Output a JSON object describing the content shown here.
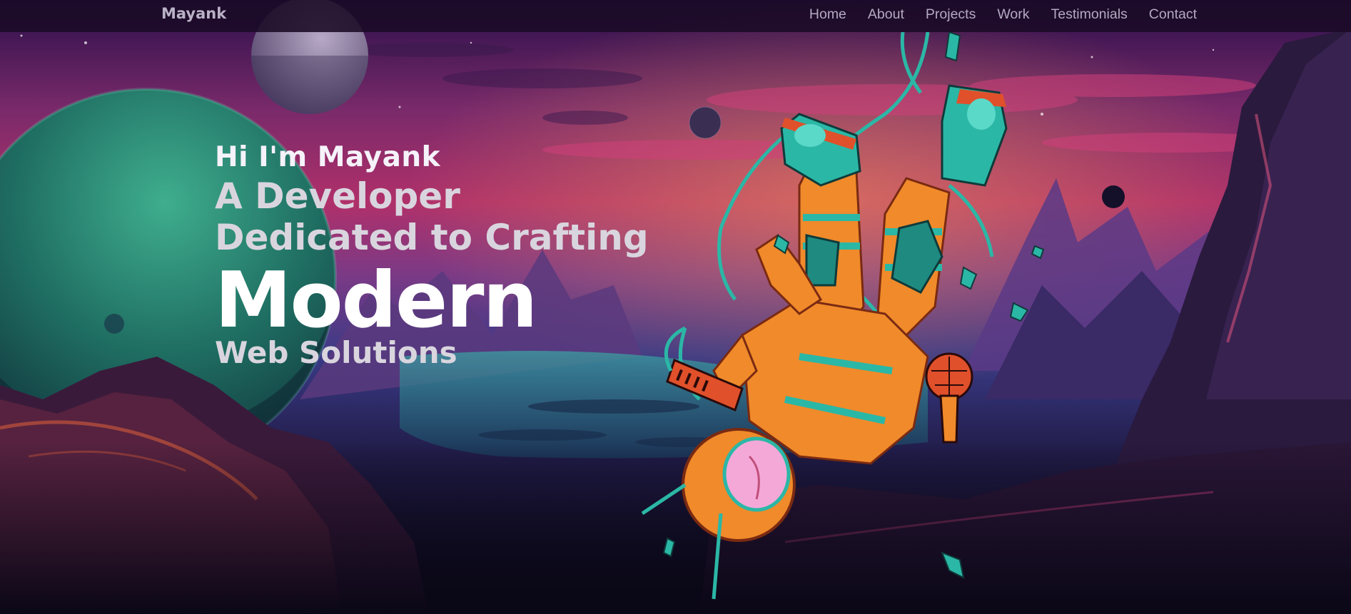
{
  "nav": {
    "brand": "Mayank",
    "links": [
      "Home",
      "About",
      "Projects",
      "Work",
      "Testimonials",
      "Contact"
    ]
  },
  "hero": {
    "greeting": "Hi I'm Mayank",
    "line1": "A Developer",
    "line2": "Dedicated to Crafting",
    "highlight": "Modern",
    "line3": "Web Solutions"
  },
  "colors": {
    "nav_background": "#1a0a26",
    "nav_text": "#b3aac1",
    "hero_text": "#ffffff",
    "hero_secondary_text": "#d9d5de",
    "sky_magenta": "#b0306a",
    "planet_green": "#2f8f78",
    "astronaut_orange": "#f08a2a",
    "astronaut_teal": "#2bb7a6"
  },
  "illustration": {
    "scene": "space-landscape",
    "elements": [
      "ringed-planet-icon",
      "moon-icon",
      "astronaut-icon",
      "keytar-icon",
      "microphone-icon",
      "mountains-icon"
    ]
  }
}
